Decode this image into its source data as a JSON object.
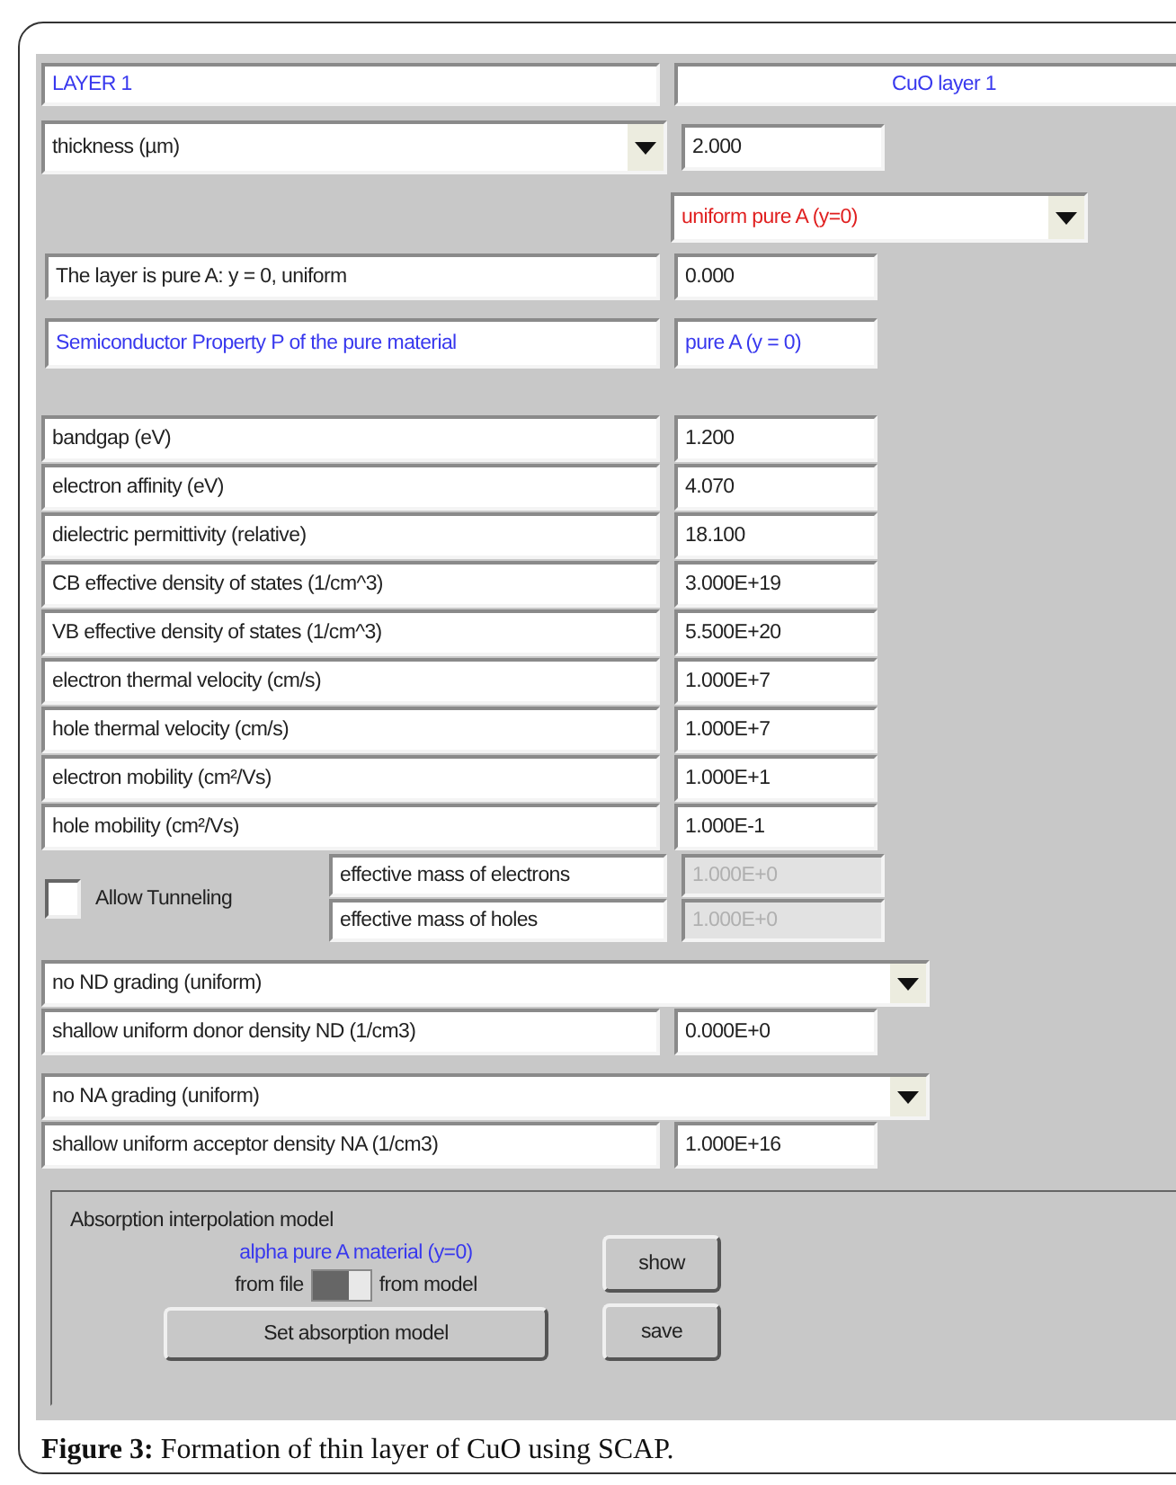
{
  "layer": {
    "name": "LAYER 1",
    "title": "CuO layer 1"
  },
  "thickness": {
    "selected_option": "thickness (µm)",
    "value": "2.000"
  },
  "composition": {
    "selected_option": "uniform pure A (y=0)"
  },
  "composition_note": {
    "label": "The layer is pure A: y = 0, uniform",
    "value": "0.000"
  },
  "property_header": {
    "label": "Semiconductor Property P of the pure material",
    "value": "pure A (y = 0)"
  },
  "properties": [
    {
      "label": "bandgap (eV)",
      "value": "1.200"
    },
    {
      "label": "electron affinity (eV)",
      "value": "4.070"
    },
    {
      "label": "dielectric permittivity (relative)",
      "value": "18.100"
    },
    {
      "label": "CB effective density of states (1/cm^3)",
      "value": "3.000E+19"
    },
    {
      "label": "VB effective density of states (1/cm^3)",
      "value": "5.500E+20"
    },
    {
      "label": "electron thermal velocity (cm/s)",
      "value": "1.000E+7"
    },
    {
      "label": "hole thermal velocity (cm/s)",
      "value": "1.000E+7"
    },
    {
      "label": "electron mobility (cm²/Vs)",
      "value": "1.000E+1"
    },
    {
      "label": "hole mobility (cm²/Vs)",
      "value": "1.000E-1"
    }
  ],
  "tunneling": {
    "label": "Allow Tunneling",
    "checked": false,
    "masses": [
      {
        "label": "effective mass of electrons",
        "value": "1.000E+0",
        "disabled": true
      },
      {
        "label": "effective mass of holes",
        "value": "1.000E+0",
        "disabled": true
      }
    ]
  },
  "donor": {
    "grading": "no ND grading (uniform)",
    "label": "shallow uniform donor density ND (1/cm3)",
    "value": "0.000E+0"
  },
  "acceptor": {
    "grading": "no NA grading (uniform)",
    "label": "shallow uniform acceptor density NA (1/cm3)",
    "value": "1.000E+16"
  },
  "absorption": {
    "title": "Absorption interpolation model",
    "material": "alpha pure A material (y=0)",
    "left_option": "from file",
    "right_option": "from model",
    "from_model": false,
    "set_button": "Set absorption model",
    "buttons": [
      "show",
      "save"
    ]
  },
  "caption": "**Figure 3:** Formation of thin layer of CuO using SCAP."
}
